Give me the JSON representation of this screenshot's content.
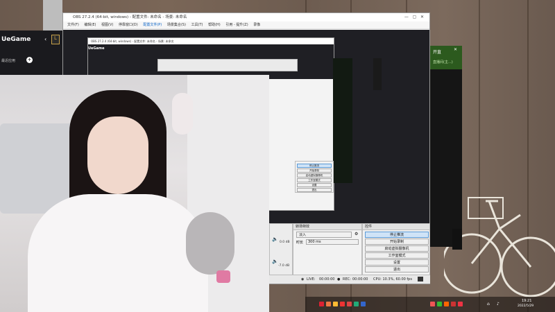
{
  "uegame": {
    "title": "UeGame",
    "menu_label": "最近应用"
  },
  "obs_window": {
    "title": "OBS 27.2.4 (64-bit, windows) - 配置文件: 未命名 - 场景: 未命名",
    "menu": [
      "文件(F)",
      "编辑(E)",
      "视图(V)",
      "停靠窗口(D)",
      "配置文件(P)",
      "场景集合(S)",
      "工具(T)",
      "帮助(H)",
      "引用 - 提升(Z)",
      "录像"
    ]
  },
  "obs_nested": {
    "title": "OBS 27.2.4 (64-bit, windows) - 配置文件: 未命名 - 场景: 未命名",
    "uegame_label": "UeGame"
  },
  "transitions_panel": {
    "header": "转场特效",
    "fade_value": "淡入",
    "duration_label": "时长",
    "duration_value": "300 ms"
  },
  "controls_panel": {
    "header": "控件",
    "buttons": [
      {
        "label": "停止推流",
        "active": true
      },
      {
        "label": "开始录制",
        "active": false
      },
      {
        "label": "启动虚拟摄像机",
        "active": false
      },
      {
        "label": "工作室模式",
        "active": false
      },
      {
        "label": "设置",
        "active": false
      },
      {
        "label": "退出",
        "active": false
      }
    ]
  },
  "mixer": {
    "level1": "0.0 dB",
    "level2": "-7.0 dB"
  },
  "status_bar": {
    "live_label": "LIVE:",
    "live_time": "00:00:00",
    "rec_label": "REC:",
    "rec_time": "00:00:00",
    "cpu": "CPU: 10.3%, 60.00 fps"
  },
  "right_panel": {
    "title": "开直",
    "item": "直播间(主...)"
  },
  "nested_controls": [
    "停止推流",
    "开始录制",
    "启动虚拟摄像机",
    "工作室模式",
    "设置",
    "退出"
  ],
  "taskbar": {
    "time": "19:21",
    "date": "2022/5/29"
  }
}
